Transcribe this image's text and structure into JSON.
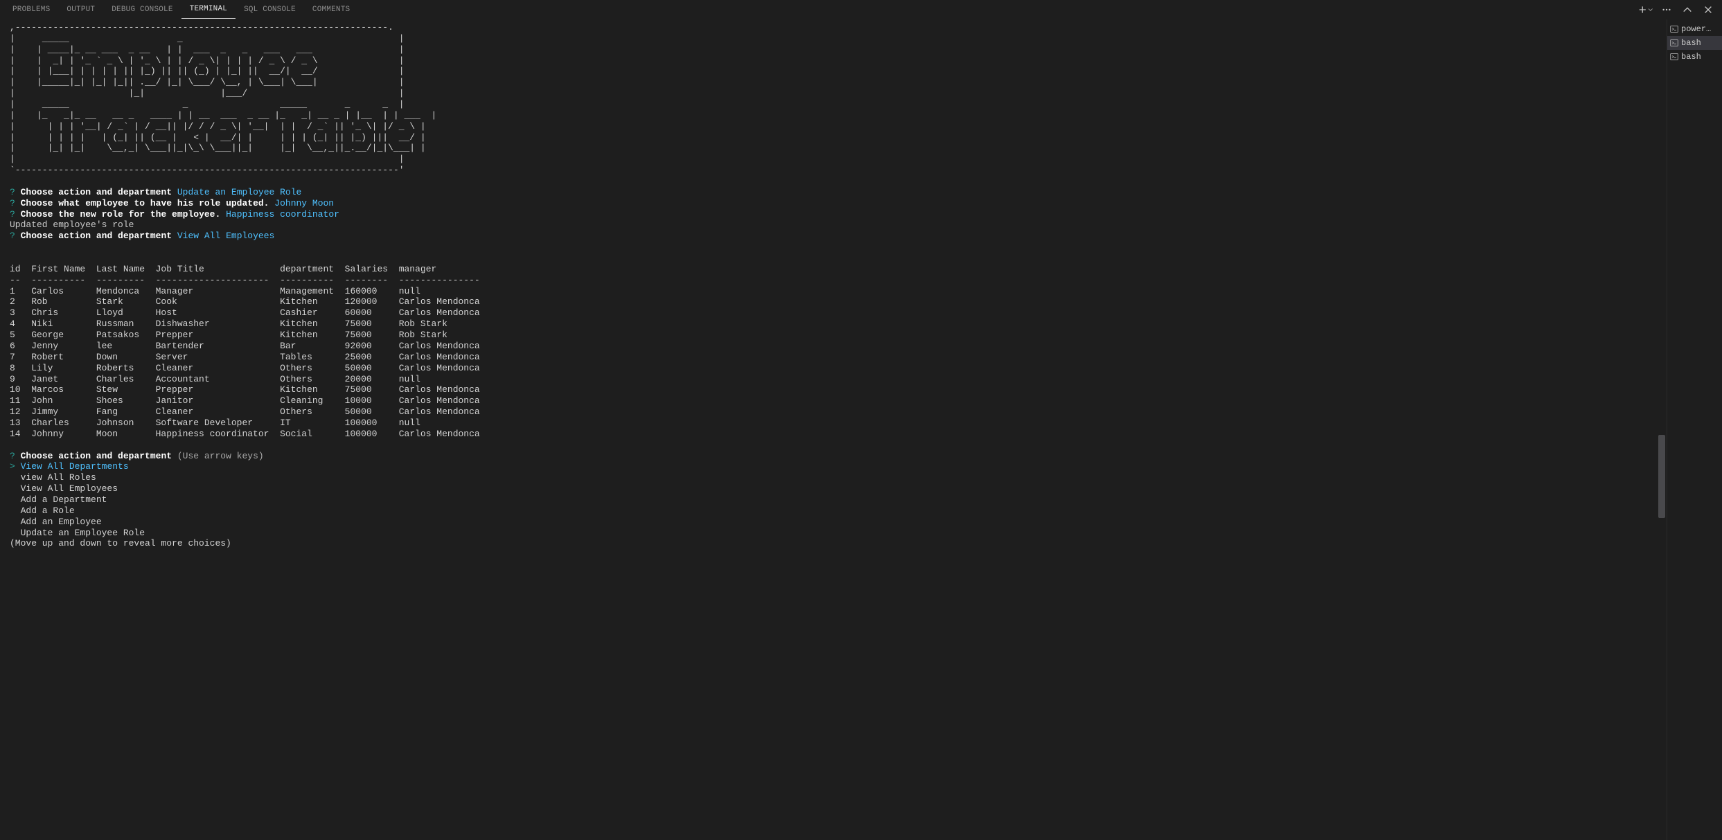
{
  "tabs": {
    "problems": "PROBLEMS",
    "output": "OUTPUT",
    "debug_console": "DEBUG CONSOLE",
    "terminal": "TERMINAL",
    "sql_console": "SQL CONSOLE",
    "comments": "COMMENTS"
  },
  "ascii_art": ",---------------------------------------------------------------------.\n|     _____                    _                                        |\n|    | ____|_ __ ___  _ __   | |  ___  _   _   ___   ___                |\n|    |  _| | '_ ` _ \\ | '_ \\ | | / _ \\| | | | / _ \\ / _ \\               |\n|    | |___| | | | | || |_) || || (_) | |_| ||  __/|  __/               |\n|    |_____|_| |_| |_|| .__/ |_| \\___/ \\__, | \\___| \\___|               |\n|                     |_|              |___/                            |\n|     _____                     _                 _____       _      _  |\n|    |_   _|_ __   __ _   ____ | | __  ___  _ __ |_   _| __ _ | |__  | | ___  |\n|      | | | '__| / _` | / __|| |/ / / _ \\| '__|  | |  / _` || '_ \\| |/ _ \\ |\n|      | | | |   | (_| || (__ |   < |  __/| |     | | | (_| || |_) |||  __/ |\n|      |_| |_|    \\__,_| \\___||_|\\_\\ \\___||_|     |_|  \\__,_||_.__/|_|\\___| |\n|                                                                       |\n`-----------------------------------------------------------------------'",
  "prompts": [
    {
      "q": "Choose action and department",
      "a": "Update an Employee Role"
    },
    {
      "q": "Choose what employee to have his role updated.",
      "a": "Johnny Moon"
    },
    {
      "q": "Choose the new role for the employee.",
      "a": "Happiness coordinator"
    }
  ],
  "updated_line": "Updated employee's role",
  "prompt_view": {
    "q": "Choose action and department",
    "a": "View All Employees"
  },
  "table": {
    "headers": [
      "id",
      "First Name",
      "Last Name",
      "Job Title",
      "department",
      "Salaries",
      "manager"
    ],
    "separator": [
      "--",
      "----------",
      "---------",
      "---------------------",
      "----------",
      "--------",
      "---------------"
    ],
    "rows": [
      [
        "1",
        "Carlos",
        "Mendonca",
        "Manager",
        "Management",
        "160000",
        "null"
      ],
      [
        "2",
        "Rob",
        "Stark",
        "Cook",
        "Kitchen",
        "120000",
        "Carlos Mendonca"
      ],
      [
        "3",
        "Chris",
        "Lloyd",
        "Host",
        "Cashier",
        "60000",
        "Carlos Mendonca"
      ],
      [
        "4",
        "Niki",
        "Russman",
        "Dishwasher",
        "Kitchen",
        "75000",
        "Rob Stark"
      ],
      [
        "5",
        "George",
        "Patsakos",
        "Prepper",
        "Kitchen",
        "75000",
        "Rob Stark"
      ],
      [
        "6",
        "Jenny",
        "lee",
        "Bartender",
        "Bar",
        "92000",
        "Carlos Mendonca"
      ],
      [
        "7",
        "Robert",
        "Down",
        "Server",
        "Tables",
        "25000",
        "Carlos Mendonca"
      ],
      [
        "8",
        "Lily",
        "Roberts",
        "Cleaner",
        "Others",
        "50000",
        "Carlos Mendonca"
      ],
      [
        "9",
        "Janet",
        "Charles",
        "Accountant",
        "Others",
        "20000",
        "null"
      ],
      [
        "10",
        "Marcos",
        "Stew",
        "Prepper",
        "Kitchen",
        "75000",
        "Carlos Mendonca"
      ],
      [
        "11",
        "John",
        "Shoes",
        "Janitor",
        "Cleaning",
        "10000",
        "Carlos Mendonca"
      ],
      [
        "12",
        "Jimmy",
        "Fang",
        "Cleaner",
        "Others",
        "50000",
        "Carlos Mendonca"
      ],
      [
        "13",
        "Charles",
        "Johnson",
        "Software Developer",
        "IT",
        "100000",
        "null"
      ],
      [
        "14",
        "Johnny",
        "Moon",
        "Happiness coordinator",
        "Social",
        "100000",
        "Carlos Mendonca"
      ]
    ]
  },
  "menu": {
    "question": "Choose action and department",
    "hint": "(Use arrow keys)",
    "options": [
      "View All Departments",
      "view All Roles",
      "View All Employees",
      "Add a Department",
      "Add a Role",
      "Add an Employee",
      "Update an Employee Role"
    ],
    "footer": "(Move up and down to reveal more choices)"
  },
  "terminals": [
    {
      "name": "power…"
    },
    {
      "name": "bash"
    },
    {
      "name": "bash"
    }
  ]
}
